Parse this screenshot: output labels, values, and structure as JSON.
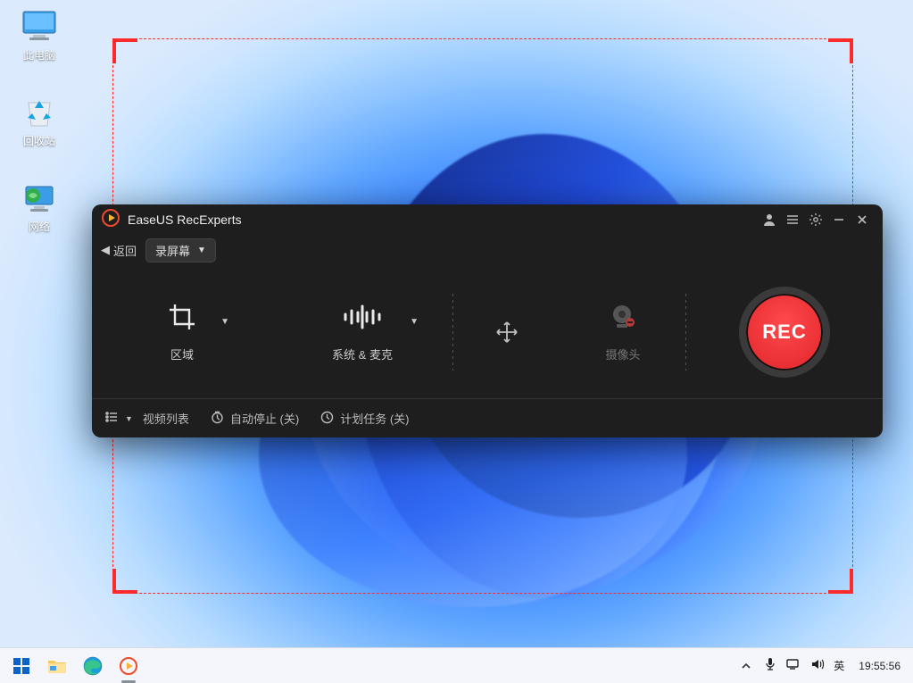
{
  "desktop": {
    "icons": [
      {
        "name": "此电脑"
      },
      {
        "name": "回收站"
      },
      {
        "name": "网络"
      }
    ]
  },
  "app": {
    "title": "EaseUS RecExperts",
    "back_label": "返回",
    "mode_label": "录屏幕",
    "options": {
      "region_label": "区域",
      "audio_label": "系统 & 麦克",
      "camera_label": "摄像头"
    },
    "rec_label": "REC",
    "bottom": {
      "videolist_label": "视频列表",
      "autostop_label": "自动停止 (关)",
      "schedule_label": "计划任务 (关)"
    }
  },
  "taskbar": {
    "ime": "英",
    "clock": "19:55:56"
  }
}
